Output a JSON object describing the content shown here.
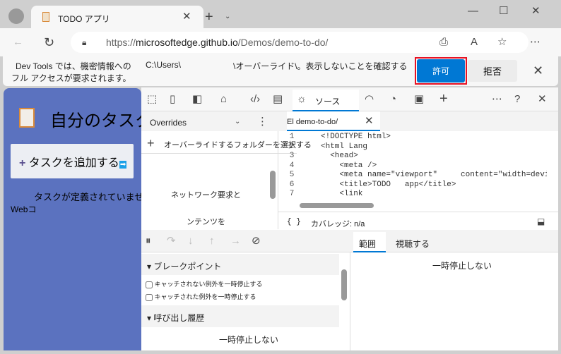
{
  "browser": {
    "tab_title": "TODO アプリ",
    "url_prefix": "https://",
    "url_host": "microsoftedge.github.io",
    "url_path": "/Demos/demo-to-do/"
  },
  "infobar": {
    "line1a": "Dev Tools では、機密情報への",
    "line1b": "C:\\Users\\",
    "line1c": "\\オーバーライド\\。表示しないことを確認する",
    "line2": "フル アクセスが要求されます。",
    "allow": "許可",
    "deny": "拒否"
  },
  "page": {
    "title": "自分のタスク",
    "add_task": "タスクを追加する",
    "empty": "タスクが定義されていません",
    "web": "Webコ"
  },
  "devtools": {
    "sources_tab": "ソース",
    "overrides_tab": "Overrides",
    "select_folder": "オーバーライドするフォルダーを選択する",
    "network_text": "ネットワーク要求と",
    "contents_text": "ンテンツを",
    "file_tab": "El demo-to-do/",
    "coverage": "カバレッジ: n/a",
    "code_lines": [
      {
        "n": "1",
        "t": "<!DOCTYPE html>"
      },
      {
        "n": "2",
        "t": "<html Lang"
      },
      {
        "n": "3",
        "t": "  <head>"
      },
      {
        "n": "4",
        "t": "    <meta />"
      },
      {
        "n": "5",
        "t": "    <meta name=\"viewport\"     content=\"width=device-"
      },
      {
        "n": "6",
        "t": "    <title>TODO   app</title>"
      },
      {
        "n": "7",
        "t": "    <link"
      }
    ],
    "breakpoints_header": "ブレークポイント",
    "bp1": "キャッチされない例外を一時停止する",
    "bp2": "キャッチされた例外を一時停止する",
    "callstack_header": "呼び出し履歴",
    "not_paused": "一時停止しない",
    "scope_tab": "範囲",
    "watch_tab": "視聴する",
    "scope_not_paused": "一時停止しない"
  },
  "colors": {
    "accent": "#0078d4",
    "page_bg": "#5b72bf",
    "highlight": "#e81123"
  }
}
